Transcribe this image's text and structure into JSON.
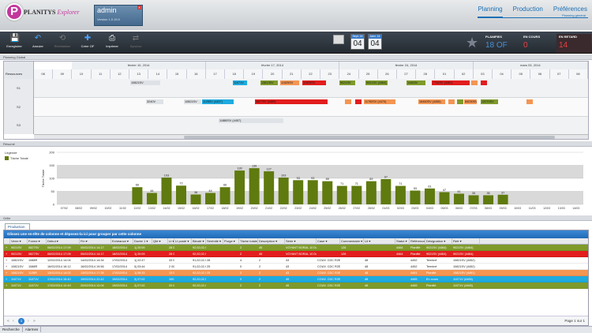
{
  "app": {
    "logo_letter": "P",
    "logo_brand": "PLANITYS",
    "logo_sub": "Explorer"
  },
  "user": {
    "name": "admin",
    "version": "Version 1.0.15.0"
  },
  "nav": {
    "tabs": [
      "Planning",
      "Production",
      "Préférences"
    ],
    "active": "Planning",
    "sub": "Planning général"
  },
  "toolbar": {
    "buttons": [
      {
        "label": "Enregistrer",
        "icon": "save-icon",
        "enabled": true
      },
      {
        "label": "Annuler",
        "icon": "undo-icon",
        "enabled": true
      },
      {
        "label": "Réinitialiser",
        "icon": "reset-icon",
        "enabled": false
      },
      {
        "label": "Créer OF",
        "icon": "plus-icon",
        "enabled": true
      },
      {
        "label": "Imprimer",
        "icon": "print-icon",
        "enabled": true
      },
      {
        "label": "Synchro",
        "icon": "sync-icon",
        "enabled": false
      }
    ],
    "date_from": {
      "label": "Sept. 14",
      "day": "04"
    },
    "date_to": {
      "label": "Janv. 14",
      "day": "04"
    },
    "stats": {
      "planifies": {
        "label": "PLANIFIES",
        "value": "18 OF"
      },
      "en_cours": {
        "label": "EN COURS",
        "value": "0"
      },
      "en_retard": {
        "label": "EN RETARD",
        "value": "14"
      }
    }
  },
  "sections": {
    "planning": "Planning Global",
    "resume": "Résumé",
    "grille": "Grille"
  },
  "gantt": {
    "resources_label": "Ressources",
    "weeks": [
      "février 10, 2014",
      "février 17, 2014",
      "février 24, 2014",
      "mars 03, 2014"
    ],
    "days": [
      "08",
      "09",
      "10",
      "11",
      "12",
      "13",
      "14",
      "15",
      "16",
      "17",
      "18",
      "19",
      "20",
      "21",
      "22",
      "23",
      "24",
      "25",
      "26",
      "27",
      "28",
      "01",
      "02",
      "03",
      "04",
      "05",
      "06",
      "07",
      "08"
    ],
    "resources": [
      "S1",
      "S2",
      "S3"
    ]
  },
  "chart_data": {
    "type": "bar",
    "ylabel": "Tâche Totale",
    "ylim": [
      0,
      200
    ],
    "yticks": [
      0,
      50,
      100,
      150,
      200
    ],
    "legend": [
      "Tâche Totale"
    ],
    "legend_position": "top-left",
    "grid": true,
    "categories": [
      "07/02",
      "08/02",
      "09/02",
      "10/02",
      "11/02",
      "12/02",
      "13/02",
      "14/02",
      "15/02",
      "16/02",
      "17/02",
      "18/02",
      "19/02",
      "20/02",
      "21/02",
      "22/02",
      "23/02",
      "24/02",
      "25/02",
      "26/02",
      "27/02",
      "28/02",
      "01/03",
      "02/03",
      "03/03",
      "04/03",
      "05/03",
      "06/03",
      "07/03",
      "08/03",
      "09/03",
      "10/03",
      "11/03",
      "12/03",
      "13/03",
      "14/03"
    ],
    "values": [
      0,
      0,
      0,
      0,
      0,
      66,
      44,
      103,
      72,
      38,
      44,
      66,
      130,
      139,
      127,
      103,
      93,
      93,
      89,
      71,
      71,
      89,
      97,
      71,
      53,
      61,
      47,
      41,
      35,
      35,
      37,
      0,
      0,
      0,
      0,
      0
    ]
  },
  "grid": {
    "tab": "Production",
    "group_hint": "Glissez une en-tête de colonne et déposez-la ici pour grouper par cette colonne",
    "columns": [
      "Verre",
      "Forme",
      "Début",
      "Fin",
      "Echéance",
      "Durée 1",
      "Qté",
      "Lt",
      "Lt posté",
      "Bleuté",
      "Sérénité",
      "Purge",
      "Tâche totale",
      "Description",
      "Série",
      "Case",
      "Commentaire",
      "Lit",
      "Statut",
      "Référence",
      "Désignation",
      "Refr"
    ],
    "rows": [
      {
        "color": "#7f9a2b",
        "cells": [
          "9021SV",
          "0827SV",
          "06/02/2014 17:09",
          "05/02/2014 14:17",
          "18/02/2014",
          "1j 20:09",
          "",
          "28 000",
          "",
          "92,02,02,94",
          "",
          "",
          "2",
          "45",
          "VOYANT BORAL 10 DAZB H+A VERRE",
          "",
          "126",
          "",
          "4464",
          "Planifié",
          "9021SV (4464)",
          "9021SV (4464)",
          ""
        ]
      },
      {
        "color": "#e21d1d",
        "cells": [
          "9021SV",
          "0827SV",
          "06/02/2014 17:09",
          "05/02/2014 14:17",
          "18/02/2014",
          "1j 20:09",
          "",
          "28 000",
          "",
          "92,02,02,94",
          "",
          "",
          "2",
          "45",
          "VOYANT BORAL 10 DAZB H+A VERRE",
          "",
          "126",
          "",
          "4464",
          "Planifié",
          "9021SV (4464)",
          "9021SV (4464)",
          ""
        ]
      },
      {
        "color": "#ffffff",
        "cells": [
          "10821SV",
          "1088R",
          "12/02/2014 14:04",
          "14/02/2014 14:34",
          "17/02/2014",
          "1j 22:47",
          "",
          "33 000",
          "",
          "91,02,02,94",
          "28",
          "",
          "4",
          "2",
          "43",
          "COUV. CDC R2E 1/3 EXCEL VERRE",
          "",
          "48",
          "",
          "4452",
          "Terminé",
          "10821SV (4452)",
          "10821SV (4452)",
          ""
        ]
      },
      {
        "color": "#ffffff",
        "cells": [
          "10821SV",
          "1088R",
          "16/02/2014 16:12",
          "16/02/2014 19:56",
          "17/02/2014",
          "0j 03:44",
          "",
          "2 000",
          "",
          "91,02,02,94",
          "25",
          "",
          "0",
          "2",
          "43",
          "COUV. CDC R2E 1/3 EXCEL VERRE",
          "",
          "48",
          "",
          "4452",
          "Terminé",
          "10821SV (4452)",
          "10821SV (4452)",
          ""
        ]
      },
      {
        "color": "#f49552",
        "cells": [
          "10821SV",
          "1128R",
          "13/02/2014 14:02",
          "13/02/2014 17:35",
          "17/02/2014",
          "1j 08:33",
          "",
          "13 000",
          "",
          "92,02,02,94",
          "25",
          "",
          "2",
          "2",
          "43",
          "COUV. CDC R2E 2/3 EXCEL VERRE",
          "",
          "48",
          "",
          "4461",
          "Planifié",
          "10821SV (4461)",
          "10821SV (4461)",
          ""
        ]
      },
      {
        "color": "#1eaadf",
        "cells": [
          "11071V",
          "11071V",
          "17/02/2014 15:40",
          "19/02/2014 22:42",
          "19/02/2014",
          "2j 07:02",
          "",
          "100 000",
          "",
          "92,02,02,94",
          "",
          "",
          "2",
          "2",
          "45",
          "COUV. CDC R2E 2/3 EXCEL VERRE",
          "",
          "48",
          "",
          "4465",
          "En cours",
          "11071V (4465)",
          "11071V (4465)",
          ""
        ]
      },
      {
        "color": "#7f9a2b",
        "cells": [
          "11071V",
          "11071V",
          "17/02/2014 12:49",
          "20/02/2014 12:04",
          "19/02/2014",
          "2j 07:02",
          "",
          "20 000",
          "",
          "92,02,02,94",
          "",
          "",
          "2",
          "2",
          "45",
          "COUV. CDC R2E 2/3 EXCEL VERRE",
          "",
          "48",
          "",
          "4465",
          "Planifié",
          "11071V (4465)",
          "11071V (4465)",
          ""
        ]
      }
    ],
    "pager": {
      "current": "1",
      "info_label": "Page",
      "info_page": "1",
      "info_sep": "sur",
      "info_total": "1"
    }
  },
  "bottom_tabs": [
    "Recherche",
    "Alarmes"
  ]
}
